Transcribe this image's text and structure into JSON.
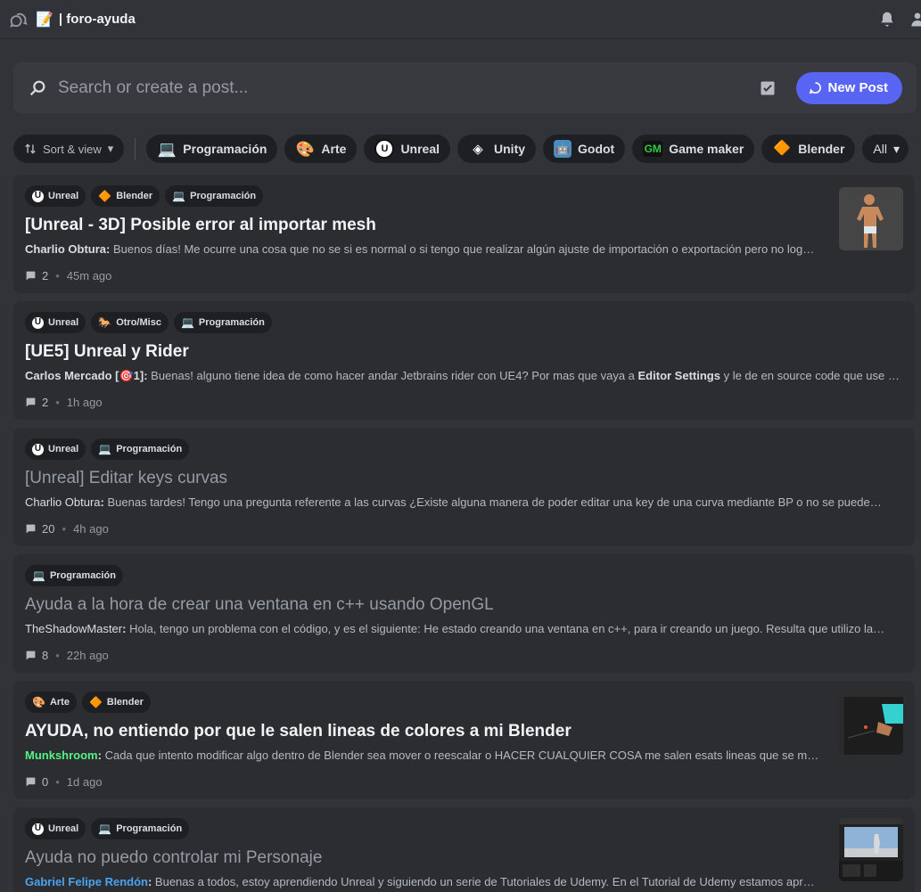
{
  "header": {
    "channel_emoji": "📝",
    "channel_name": "| foro-ayuda"
  },
  "search": {
    "placeholder": "Search or create a post...",
    "new_post_label": "New Post"
  },
  "filters": {
    "sort_label": "Sort & view",
    "tags": [
      {
        "emoji": "💻",
        "label": "Programación"
      },
      {
        "emoji": "🎨",
        "label": "Arte"
      },
      {
        "emoji": "U",
        "label": "Unreal"
      },
      {
        "emoji": "◈",
        "label": "Unity"
      },
      {
        "emoji": "🤖",
        "label": "Godot"
      },
      {
        "emoji": "GM",
        "label": "Game maker"
      },
      {
        "emoji": "🔶",
        "label": "Blender"
      }
    ],
    "all_label": "All"
  },
  "posts": [
    {
      "tags": [
        [
          "U",
          "Unreal"
        ],
        [
          "🔶",
          "Blender"
        ],
        [
          "💻",
          "Programación"
        ]
      ],
      "title": "[Unreal - 3D] Posible error al importar mesh",
      "author": "Charlio Obtura",
      "snippet": "Buenos días! Me ocurre una cosa que no se si es normal o si tengo que realizar algún ajuste de importación o exportación pero no log…",
      "comments": "2",
      "time": "45m ago"
    },
    {
      "tags": [
        [
          "U",
          "Unreal"
        ],
        [
          "🐎",
          "Otro/Misc"
        ],
        [
          "💻",
          "Programación"
        ]
      ],
      "title": "[UE5] Unreal y Rider",
      "author": "Carlos Mercado [🎯1]",
      "snippet_pre": "Buenas! alguno tiene idea de como hacer andar Jetbrains rider con UE4? Por mas que vaya a ",
      "snippet_bold": "Editor Settings",
      "snippet_post": " y le de en source code que use …",
      "comments": "2",
      "time": "1h ago"
    },
    {
      "tags": [
        [
          "U",
          "Unreal"
        ],
        [
          "💻",
          "Programación"
        ]
      ],
      "title": "[Unreal] Editar keys curvas",
      "author": "Charlio Obtura",
      "snippet": "Buenas tardes! Tengo una pregunta referente a las curvas ¿Existe alguna manera de poder editar una key de una curva mediante BP o no se puede…",
      "comments": "20",
      "time": "4h ago"
    },
    {
      "tags": [
        [
          "💻",
          "Programación"
        ]
      ],
      "title": "Ayuda a la hora de crear una ventana en c++ usando OpenGL",
      "author": "TheShadowMaster",
      "snippet": "Hola, tengo un problema con el código, y es el siguiente: He estado creando una ventana en c++, para ir creando un juego. Resulta que utilizo la…",
      "comments": "8",
      "time": "22h ago"
    },
    {
      "tags": [
        [
          "🎨",
          "Arte"
        ],
        [
          "🔶",
          "Blender"
        ]
      ],
      "title": "AYUDA, no entiendo por que le salen lineas de colores a mi Blender",
      "author": "Munkshroom",
      "snippet": "Cada que intento modificar algo dentro de Blender sea mover o reescalar o HACER CUALQUIER COSA me salen esats lineas que se m…",
      "comments": "0",
      "time": "1d ago"
    },
    {
      "tags": [
        [
          "U",
          "Unreal"
        ],
        [
          "💻",
          "Programación"
        ]
      ],
      "title": "Ayuda no puedo controlar mi Personaje",
      "author": "Gabriel Felipe Rendón",
      "snippet": "Buenas a todos, estoy aprendiendo Unreal y siguiendo un serie de Tutoriales de Udemy. En el Tutorial de Udemy estamos apr…",
      "comments": "",
      "time": ""
    }
  ]
}
